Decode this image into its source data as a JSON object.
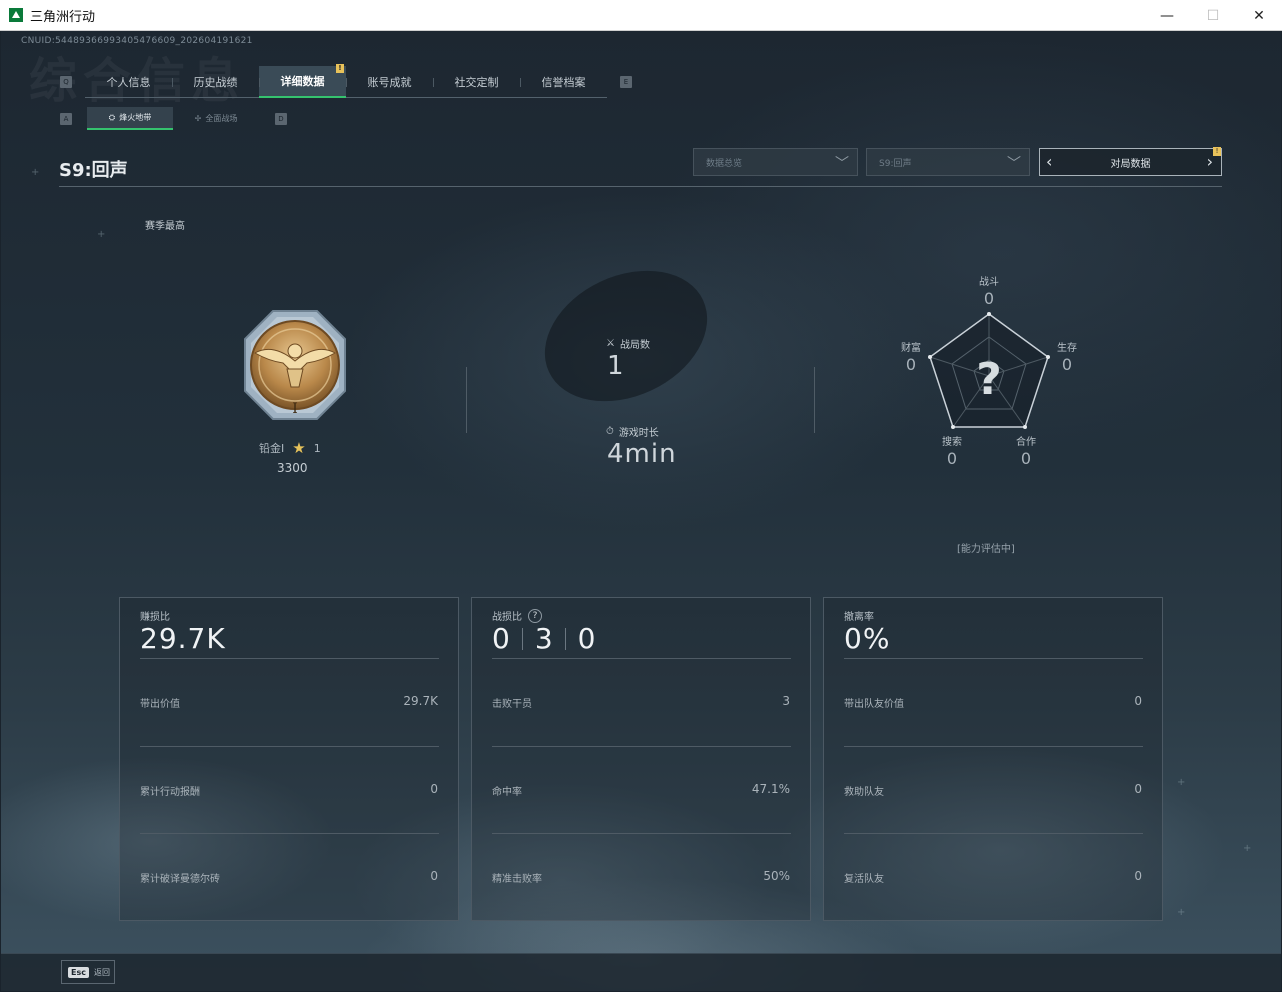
{
  "window": {
    "title": "三角洲行动",
    "minimize": "—",
    "maximize": "☐",
    "close": "✕"
  },
  "header": {
    "cnuid": "CNUID:544893669934054766​09_202604191621",
    "watermark": "综合信息"
  },
  "tabs": {
    "left_key": "Q",
    "right_key": "E",
    "items": [
      {
        "label": "个人信息"
      },
      {
        "label": "历史战绩"
      },
      {
        "label": "详细数据",
        "active": true,
        "badge": "!"
      },
      {
        "label": "账号成就"
      },
      {
        "label": "社交定制"
      },
      {
        "label": "信誉档案"
      }
    ]
  },
  "subtabs": {
    "left_key": "A",
    "right_key": "D",
    "items": [
      {
        "label": "烽火地带",
        "active": true
      },
      {
        "label": "全面战场"
      }
    ]
  },
  "season": {
    "title": "S9:回声",
    "best_label": "赛季最高"
  },
  "filters": {
    "data_scope": "数据总览",
    "season_select": "S9:回声",
    "pager_label": "对局数据",
    "pager_badge": "!"
  },
  "rank": {
    "tier": "铅金I",
    "stars": "1",
    "score": "3300",
    "medal_numeral": "I"
  },
  "summary": {
    "matches_label": "战局数",
    "matches_value": "1",
    "time_label": "游戏时长",
    "time_value": "4min"
  },
  "radar": {
    "center_mark": "?",
    "note": "[能力评估中]",
    "axes": [
      {
        "label": "战斗",
        "value": "0"
      },
      {
        "label": "生存",
        "value": "0"
      },
      {
        "label": "合作",
        "value": "0"
      },
      {
        "label": "搜索",
        "value": "0"
      },
      {
        "label": "财富",
        "value": "0"
      }
    ]
  },
  "panels": {
    "profit": {
      "title": "赚损比",
      "value": "29.7K",
      "rows": [
        {
          "label": "带出价值",
          "value": "29.7K"
        },
        {
          "label": "累计行动报酬",
          "value": "0"
        },
        {
          "label": "累计破译曼德尔砖",
          "value": "0"
        }
      ]
    },
    "combat": {
      "title": "战损比",
      "help": "?",
      "kda": [
        "0",
        "3",
        "0"
      ],
      "rows": [
        {
          "label": "击败干员",
          "value": "3"
        },
        {
          "label": "命中率",
          "value": "47.1%"
        },
        {
          "label": "精准击败率",
          "value": "50%"
        }
      ]
    },
    "extract": {
      "title": "撤离率",
      "value": "0%",
      "rows": [
        {
          "label": "带出队友价值",
          "value": "0"
        },
        {
          "label": "救助队友",
          "value": "0"
        },
        {
          "label": "复活队友",
          "value": "0"
        }
      ]
    }
  },
  "footer": {
    "esc_key": "Esc",
    "esc_label": "返回"
  },
  "colors": {
    "accent_green": "#35c36e",
    "badge_yellow": "#e8c25a",
    "medal_gold": "#c99a52"
  }
}
